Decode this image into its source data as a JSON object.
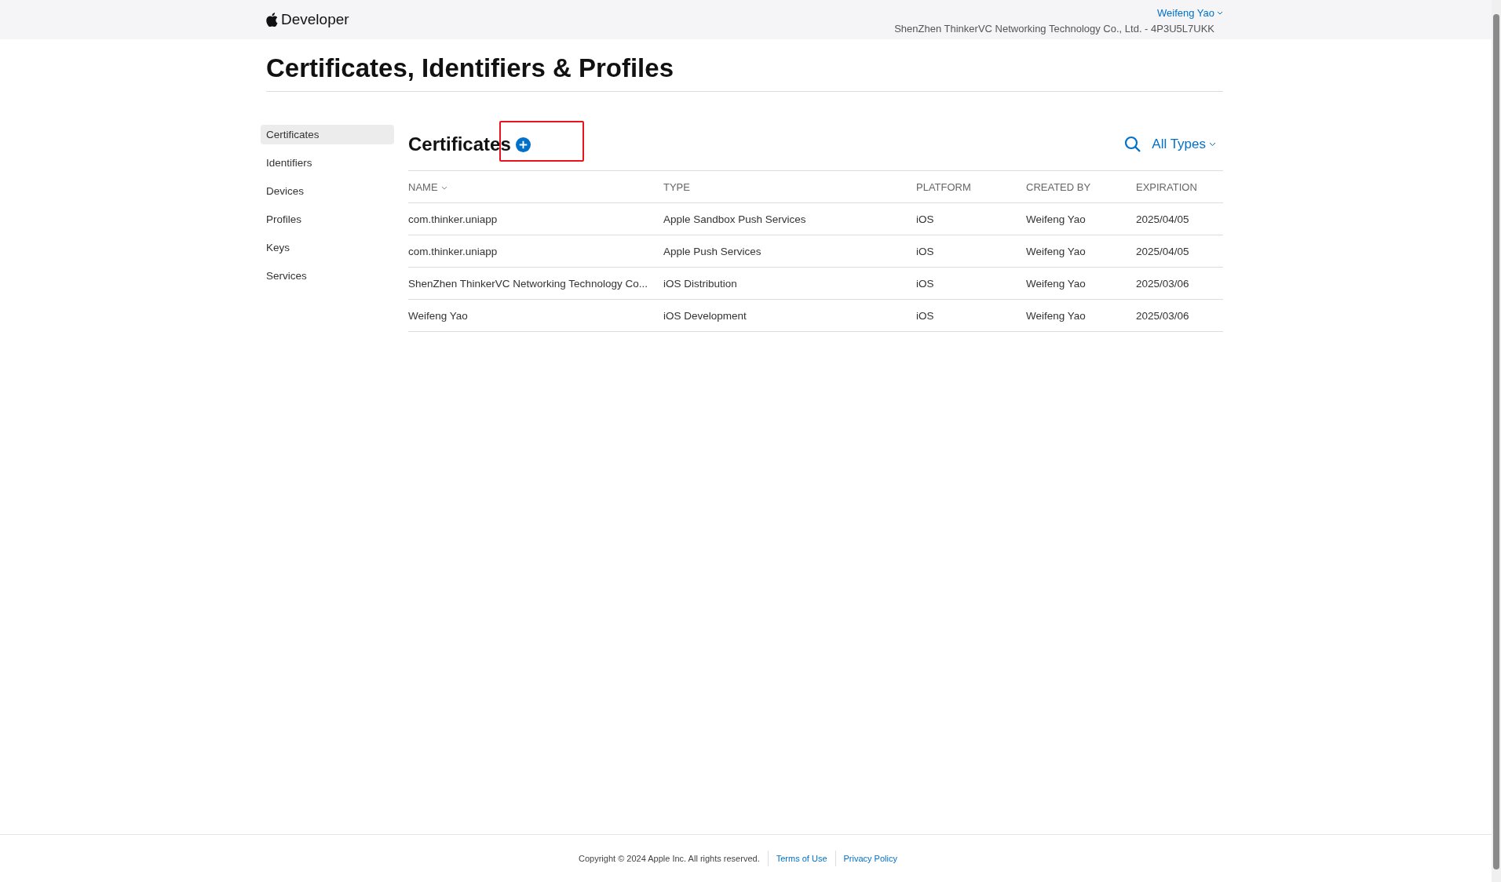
{
  "header": {
    "brand": "Developer",
    "user": "Weifeng Yao",
    "team": "ShenZhen ThinkerVC Networking Technology Co., Ltd. - 4P3U5L7UKK"
  },
  "page_title": "Certificates, Identifiers & Profiles",
  "sidebar": {
    "items": [
      {
        "label": "Certificates",
        "selected": true
      },
      {
        "label": "Identifiers",
        "selected": false
      },
      {
        "label": "Devices",
        "selected": false
      },
      {
        "label": "Profiles",
        "selected": false
      },
      {
        "label": "Keys",
        "selected": false
      },
      {
        "label": "Services",
        "selected": false
      }
    ]
  },
  "section": {
    "title": "Certificates",
    "filter": "All Types"
  },
  "table": {
    "columns": [
      {
        "label": "NAME",
        "sorted": true
      },
      {
        "label": "TYPE",
        "sorted": false
      },
      {
        "label": "PLATFORM",
        "sorted": false
      },
      {
        "label": "CREATED BY",
        "sorted": false
      },
      {
        "label": "EXPIRATION",
        "sorted": false
      }
    ],
    "rows": [
      [
        "com.thinker.uniapp",
        "Apple Sandbox Push Services",
        "iOS",
        "Weifeng Yao",
        "2025/04/05"
      ],
      [
        "com.thinker.uniapp",
        "Apple Push Services",
        "iOS",
        "Weifeng Yao",
        "2025/04/05"
      ],
      [
        "ShenZhen ThinkerVC Networking Technology Co...",
        "iOS Distribution",
        "iOS",
        "Weifeng Yao",
        "2025/03/06"
      ],
      [
        "Weifeng Yao",
        "iOS Development",
        "iOS",
        "Weifeng Yao",
        "2025/03/06"
      ]
    ]
  },
  "footer": {
    "copyright": "Copyright © 2024 Apple Inc. All rights reserved.",
    "links": [
      "Terms of Use",
      "Privacy Policy"
    ]
  }
}
